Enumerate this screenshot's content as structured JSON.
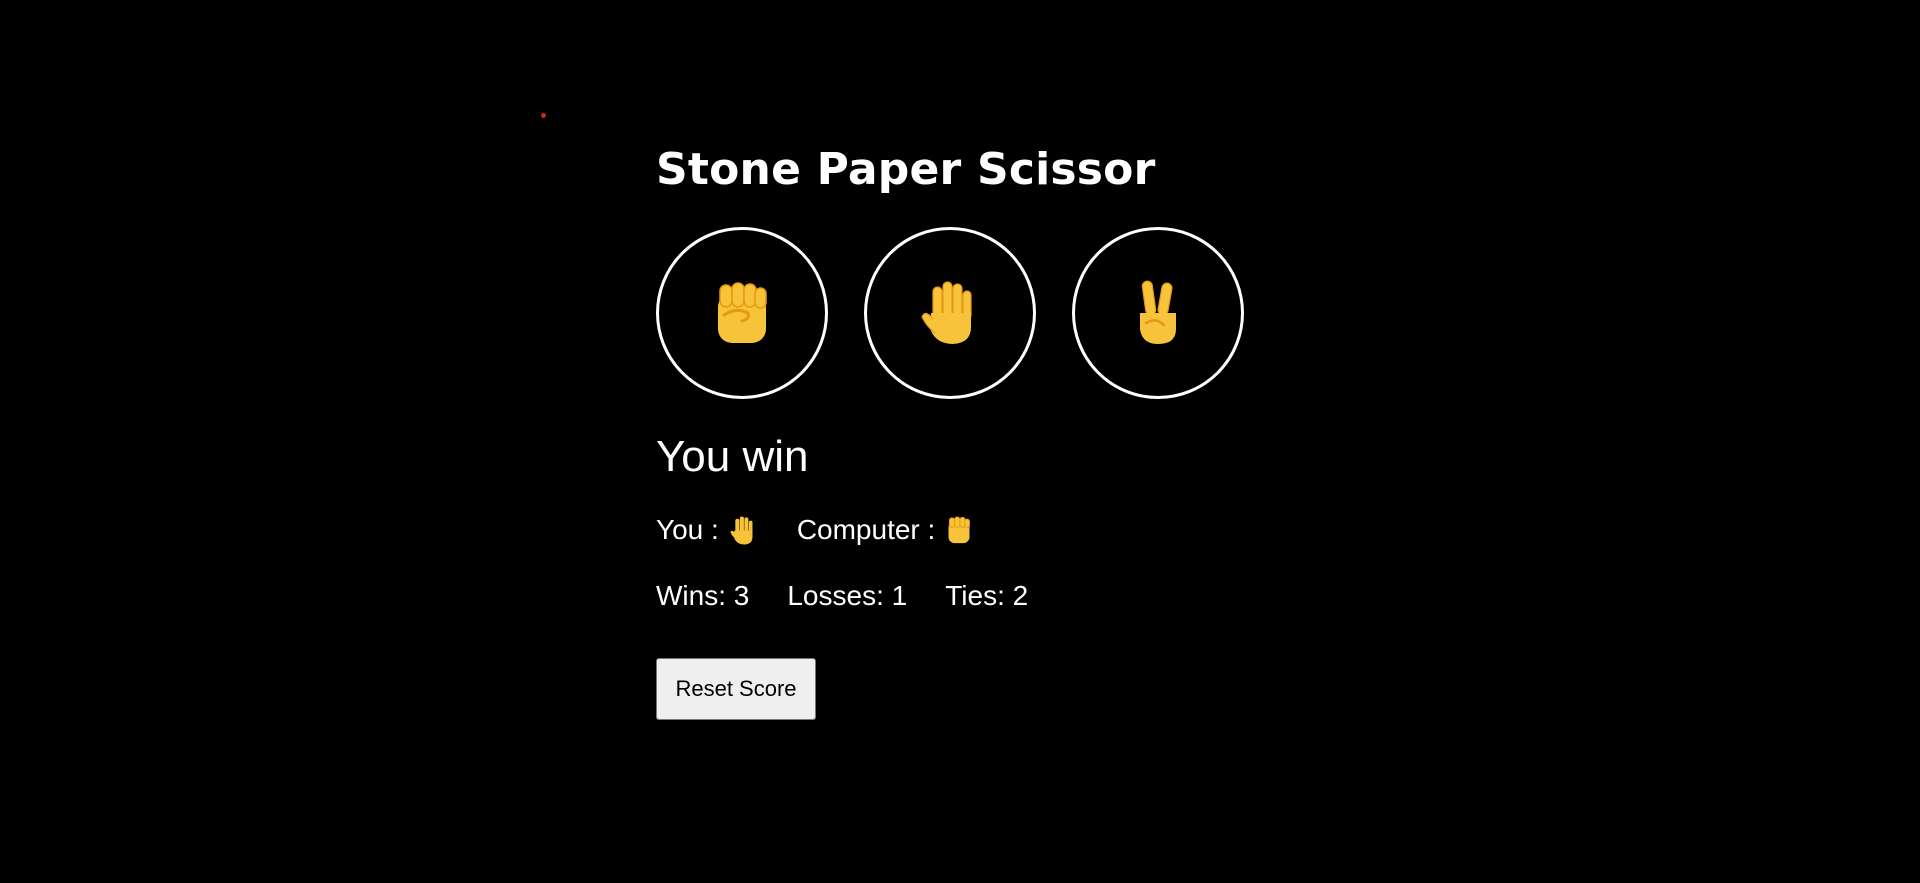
{
  "title": "Stone Paper Scissor",
  "choices": [
    {
      "name": "stone",
      "icon": "raised-fist-icon"
    },
    {
      "name": "paper",
      "icon": "raised-hand-icon"
    },
    {
      "name": "scissor",
      "icon": "victory-hand-icon"
    }
  ],
  "result": "You win",
  "moves": {
    "you_label": "You :",
    "you_icon": "raised-hand-icon",
    "computer_label": "Computer :",
    "computer_icon": "raised-fist-icon"
  },
  "score": {
    "wins": "Wins: 3",
    "losses": "Losses: 1",
    "ties": "Ties: 2"
  },
  "reset_label": "Reset Score",
  "colors": {
    "background": "#000000",
    "text": "#ffffff",
    "emoji": "#f6c33b",
    "emoji_shade": "#e59a10",
    "button_bg": "#efefef"
  }
}
